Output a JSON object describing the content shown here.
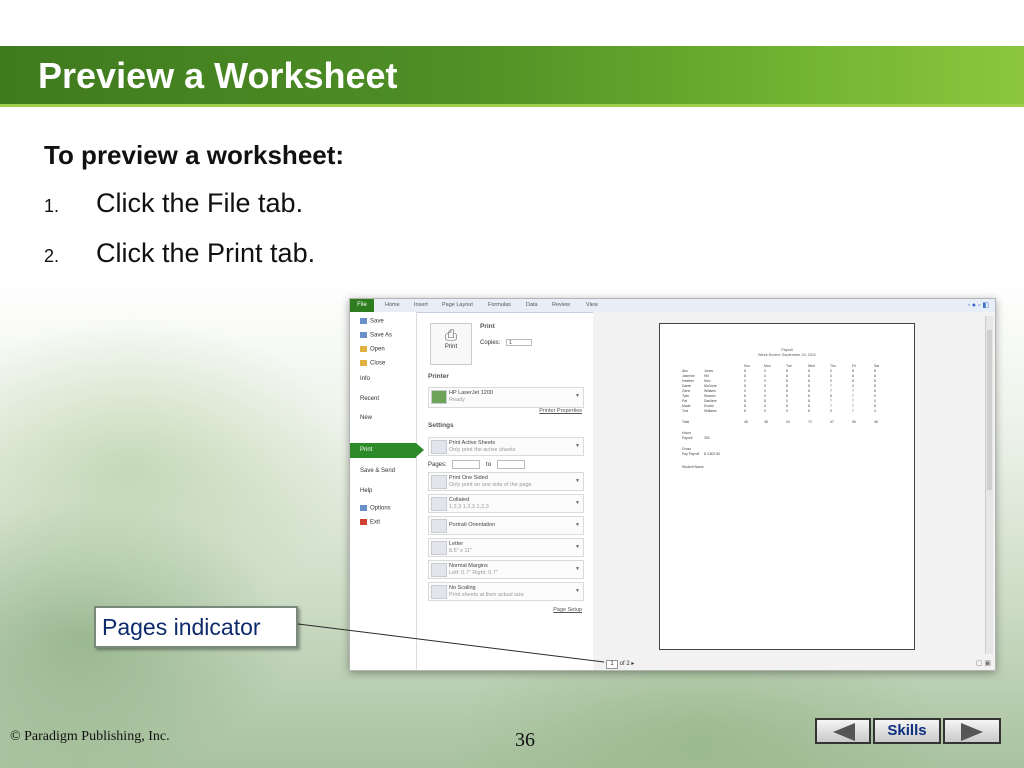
{
  "slide": {
    "title": "Preview a Worksheet",
    "subheading": "To preview a worksheet:",
    "steps": [
      {
        "num": "1.",
        "text": "Click the File tab."
      },
      {
        "num": "2.",
        "text": "Click the Print tab."
      }
    ],
    "callout": "Pages indicator",
    "copyright": "© Paradigm Publishing, Inc.",
    "page_number": "36",
    "skills_label": "Skills",
    "colors": {
      "title_bar": "#4f8f25",
      "accent_green": "#8cc63f",
      "callout_text": "#0d2b6b"
    }
  },
  "excel": {
    "ribbon_tabs": [
      "File",
      "Home",
      "Insert",
      "Page Layout",
      "Formulas",
      "Data",
      "Review",
      "View"
    ],
    "nav": {
      "save": "Save",
      "save_as": "Save As",
      "open": "Open",
      "close": "Close",
      "info": "Info",
      "recent": "Recent",
      "new": "New",
      "print": "Print",
      "save_send": "Save & Send",
      "help": "Help",
      "options": "Options",
      "exit": "Exit"
    },
    "print_section": {
      "heading": "Print",
      "button": "Print",
      "copies_label": "Copies:",
      "copies_value": "1"
    },
    "printer": {
      "heading": "Printer",
      "name": "HP LaserJet 1200",
      "status": "Ready",
      "properties_link": "Printer Properties"
    },
    "settings": {
      "heading": "Settings",
      "active_sheets": {
        "main": "Print Active Sheets",
        "sub": "Only print the active sheets"
      },
      "pages_label": "Pages:",
      "pages_to": "to",
      "sides": {
        "main": "Print One Sided",
        "sub": "Only print on one side of the page"
      },
      "collated": {
        "main": "Collated",
        "sub": "1,2,3   1,2,3   1,2,3"
      },
      "orientation": {
        "main": "Portrait Orientation",
        "sub": ""
      },
      "paper": {
        "main": "Letter",
        "sub": "8.5\" x 11\""
      },
      "margins": {
        "main": "Normal Margins",
        "sub": "Left: 0.7\"   Right: 0.7\""
      },
      "scaling": {
        "main": "No Scaling",
        "sub": "Print sheets at their actual size"
      },
      "page_setup_link": "Page Setup"
    },
    "pager": {
      "current": "1",
      "total_text": "of 2 ▸"
    },
    "preview": {
      "title": "Payroll",
      "subtitle": "Week Ended: September 24, 2011",
      "columns": [
        "",
        "",
        "Sun",
        "Mon",
        "Tue",
        "Wed",
        "Thu",
        "Fri",
        "Sat"
      ],
      "rows": [
        [
          "Abc",
          "Jones",
          "8",
          "0",
          "8",
          "8",
          "0",
          "8",
          "8"
        ],
        [
          "Jasmine",
          "Hill",
          "8",
          "0",
          "8",
          "8",
          "0",
          "8",
          "8"
        ],
        [
          "Heather",
          "Kiev",
          "0",
          "0",
          "8",
          "8",
          "0",
          "8",
          "8"
        ],
        [
          "Dante",
          "McGuire",
          "8",
          "0",
          "8",
          "8",
          "7",
          "0",
          "8"
        ],
        [
          "Gene",
          "Wiliams",
          "0",
          "0",
          "8",
          "8",
          "7",
          "7",
          "8"
        ],
        [
          "Tyler",
          "Seamin",
          "8",
          "0",
          "8",
          "8",
          "8",
          "7",
          "0"
        ],
        [
          "Pat",
          "Dauliere",
          "8",
          "8",
          "0",
          "8",
          "7",
          "7",
          "0"
        ],
        [
          "Marie",
          "Dustin",
          "8",
          "0",
          "8",
          "8",
          "7",
          "7",
          "8"
        ],
        [
          "Toni",
          "Williams",
          "8",
          "0",
          "0",
          "8",
          "0",
          "7",
          "4"
        ]
      ],
      "total_row": [
        "Total",
        "",
        "48",
        "38",
        "44",
        "72",
        "47",
        "56",
        "48"
      ],
      "hours_label": "Hours",
      "payroll_label": "Payroll",
      "payroll_value": "392",
      "gross_label": "Gross",
      "pay_label": "Pay Payroll",
      "pay_value": "$ 3,802.50",
      "student_label": "Student Name"
    }
  }
}
